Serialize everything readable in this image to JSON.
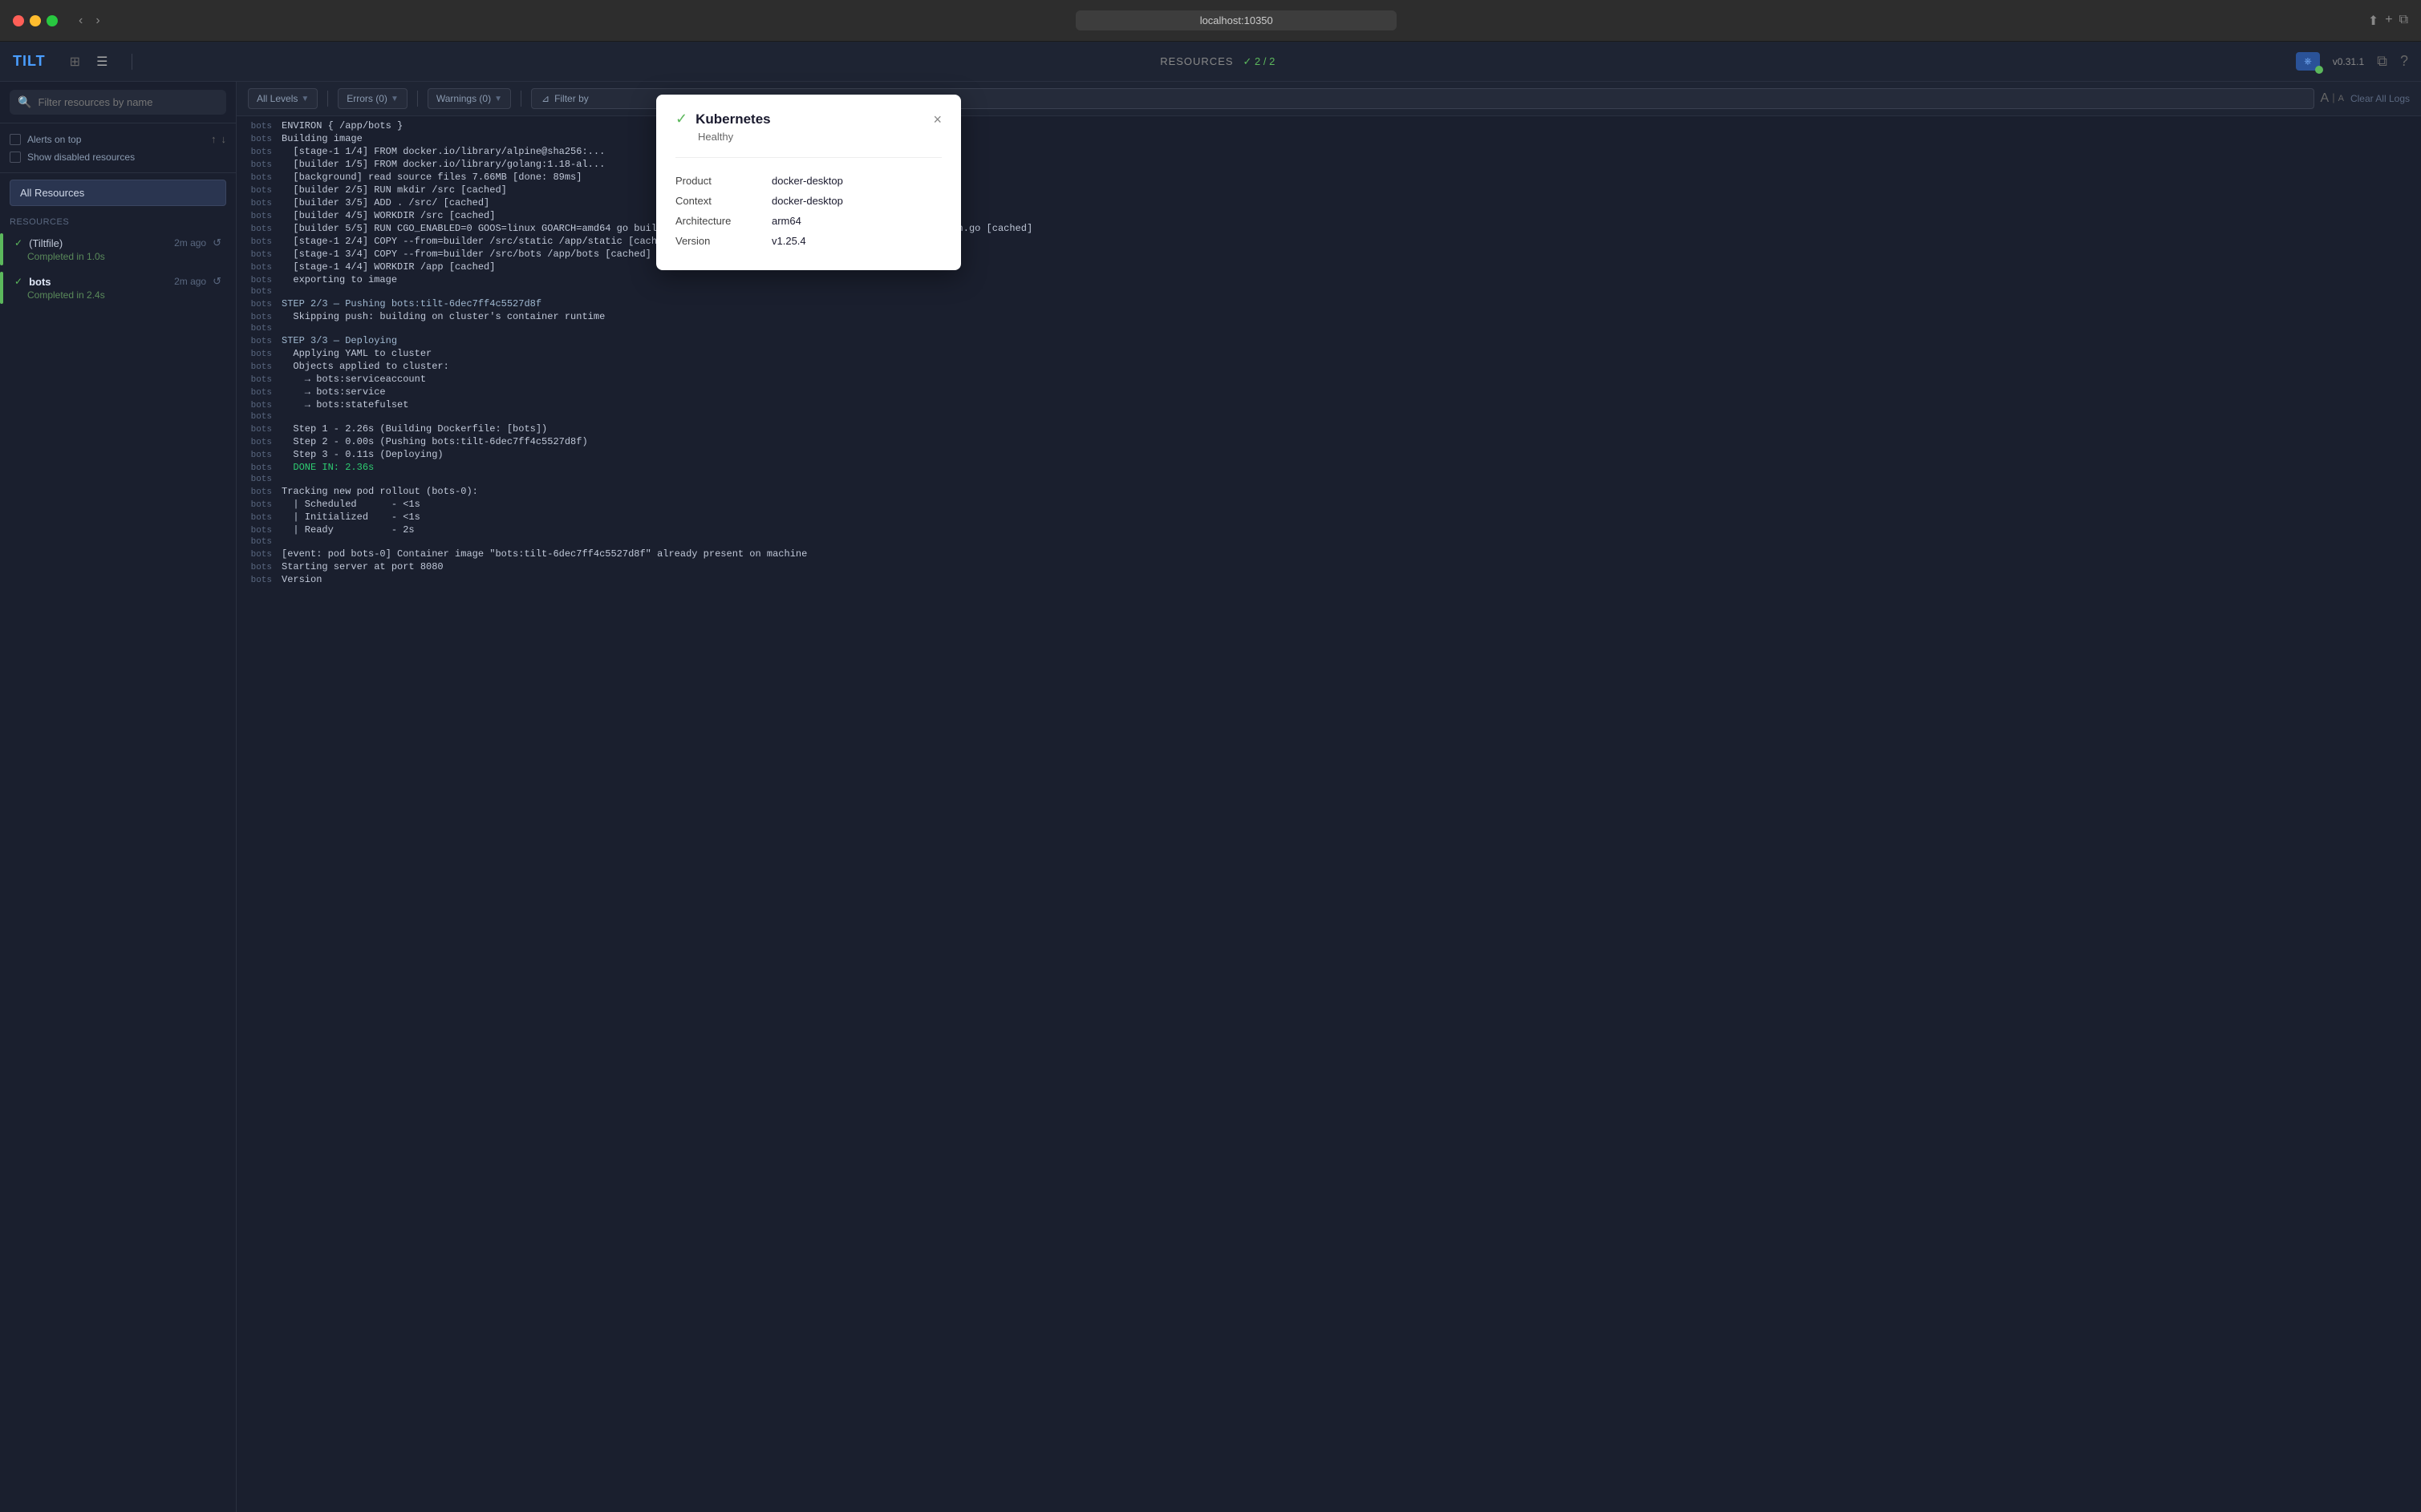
{
  "browser": {
    "url": "localhost:10350",
    "back_btn": "‹",
    "forward_btn": "›"
  },
  "header": {
    "logo": "TILT",
    "resources_label": "RESOURCES",
    "resources_count": "✓ 2 / 2",
    "version": "v0.31.1",
    "k8s_btn_label": "k8s",
    "clear_all_logs": "Clear All Logs"
  },
  "sidebar": {
    "search_placeholder": "Filter resources by name",
    "alerts_on_top": "Alerts on top",
    "show_disabled": "Show disabled resources",
    "all_resources": "All Resources",
    "resources_section": "RESOURCES",
    "items": [
      {
        "name": "(Tiltfile)",
        "time": "2m ago",
        "subtitle": "Completed in 1.0s",
        "status": "green",
        "bold": false
      },
      {
        "name": "bots",
        "time": "2m ago",
        "subtitle": "Completed in 2.4s",
        "status": "green",
        "bold": true
      }
    ]
  },
  "toolbar": {
    "all_levels": "All Levels",
    "errors": "Errors (0)",
    "warnings": "Warnings (0)",
    "filter_by": "Filter by",
    "font_a_large": "A",
    "font_a_small": "A",
    "clear_all_logs": "Clear All Logs"
  },
  "logs": [
    {
      "source": "bots",
      "text": "ENVIRON { /app/bots }"
    },
    {
      "source": "bots",
      "text": "Building image"
    },
    {
      "source": "bots",
      "text": "  [stage-1 1/4] FROM docker.io/library/alpine@sha256:..."
    },
    {
      "source": "bots",
      "text": "  [builder 1/5] FROM docker.io/library/golang:1.18-al..."
    },
    {
      "source": "bots",
      "text": "  [background] read source files 7.66MB [done: 89ms]"
    },
    {
      "source": "bots",
      "text": "  [builder 2/5] RUN mkdir /src [cached]"
    },
    {
      "source": "bots",
      "text": "  [builder 3/5] ADD . /src/ [cached]"
    },
    {
      "source": "bots",
      "text": "  [builder 4/5] WORKDIR /src [cached]"
    },
    {
      "source": "bots",
      "text": "  [builder 5/5] RUN CGO_ENABLED=0 GOOS=linux GOARCH=amd64 go build -ldflags \"-X main.Version=$VERSION\" -a -o bots main.go [cached]"
    },
    {
      "source": "bots",
      "text": "  [stage-1 2/4] COPY --from=builder /src/static /app/static [cached]"
    },
    {
      "source": "bots",
      "text": "  [stage-1 3/4] COPY --from=builder /src/bots /app/bots [cached]"
    },
    {
      "source": "bots",
      "text": "  [stage-1 4/4] WORKDIR /app [cached]"
    },
    {
      "source": "bots",
      "text": "  exporting to image"
    },
    {
      "source": "bots",
      "text": ""
    },
    {
      "source": "bots",
      "text": "STEP 2/3 — Pushing bots:tilt-6dec7ff4c5527d8f",
      "type": "step"
    },
    {
      "source": "bots",
      "text": "  Skipping push: building on cluster's container runtime"
    },
    {
      "source": "bots",
      "text": ""
    },
    {
      "source": "bots",
      "text": "STEP 3/3 — Deploying",
      "type": "step"
    },
    {
      "source": "bots",
      "text": "  Applying YAML to cluster"
    },
    {
      "source": "bots",
      "text": "  Objects applied to cluster:"
    },
    {
      "source": "bots",
      "text": "    → bots:serviceaccount"
    },
    {
      "source": "bots",
      "text": "    → bots:service"
    },
    {
      "source": "bots",
      "text": "    → bots:statefulset"
    },
    {
      "source": "bots",
      "text": ""
    },
    {
      "source": "bots",
      "text": "  Step 1 - 2.26s (Building Dockerfile: [bots])"
    },
    {
      "source": "bots",
      "text": "  Step 2 - 0.00s (Pushing bots:tilt-6dec7ff4c5527d8f)"
    },
    {
      "source": "bots",
      "text": "  Step 3 - 0.11s (Deploying)"
    },
    {
      "source": "bots",
      "text": "  DONE IN: 2.36s",
      "type": "green"
    },
    {
      "source": "bots",
      "text": ""
    },
    {
      "source": "bots",
      "text": "Tracking new pod rollout (bots-0):"
    },
    {
      "source": "bots",
      "text": "  | Scheduled      - <1s"
    },
    {
      "source": "bots",
      "text": "  | Initialized    - <1s"
    },
    {
      "source": "bots",
      "text": "  | Ready          - 2s"
    },
    {
      "source": "bots",
      "text": ""
    },
    {
      "source": "bots",
      "text": "[event: pod bots-0] Container image \"bots:tilt-6dec7ff4c5527d8f\" already present on machine"
    },
    {
      "source": "bots",
      "text": "Starting server at port 8080"
    },
    {
      "source": "bots",
      "text": "Version"
    }
  ],
  "k8s_popup": {
    "title": "Kubernetes",
    "status": "Healthy",
    "close": "×",
    "fields": [
      {
        "key": "Product",
        "value": "docker-desktop"
      },
      {
        "key": "Context",
        "value": "docker-desktop"
      },
      {
        "key": "Architecture",
        "value": "arm64"
      },
      {
        "key": "Version",
        "value": "v1.25.4"
      }
    ]
  }
}
